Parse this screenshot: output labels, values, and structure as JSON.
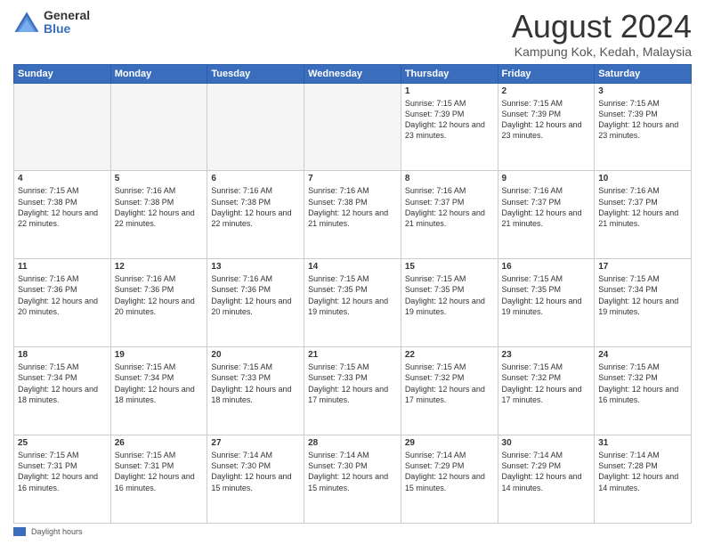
{
  "logo": {
    "general": "General",
    "blue": "Blue"
  },
  "header": {
    "month_year": "August 2024",
    "location": "Kampung Kok, Kedah, Malaysia"
  },
  "days_of_week": [
    "Sunday",
    "Monday",
    "Tuesday",
    "Wednesday",
    "Thursday",
    "Friday",
    "Saturday"
  ],
  "footer": {
    "swatch_label": "Daylight hours"
  },
  "weeks": [
    [
      {
        "day": "",
        "empty": true
      },
      {
        "day": "",
        "empty": true
      },
      {
        "day": "",
        "empty": true
      },
      {
        "day": "",
        "empty": true
      },
      {
        "day": "1",
        "sunrise": "7:15 AM",
        "sunset": "7:39 PM",
        "daylight": "12 hours and 23 minutes."
      },
      {
        "day": "2",
        "sunrise": "7:15 AM",
        "sunset": "7:39 PM",
        "daylight": "12 hours and 23 minutes."
      },
      {
        "day": "3",
        "sunrise": "7:15 AM",
        "sunset": "7:39 PM",
        "daylight": "12 hours and 23 minutes."
      }
    ],
    [
      {
        "day": "4",
        "sunrise": "7:15 AM",
        "sunset": "7:38 PM",
        "daylight": "12 hours and 22 minutes."
      },
      {
        "day": "5",
        "sunrise": "7:16 AM",
        "sunset": "7:38 PM",
        "daylight": "12 hours and 22 minutes."
      },
      {
        "day": "6",
        "sunrise": "7:16 AM",
        "sunset": "7:38 PM",
        "daylight": "12 hours and 22 minutes."
      },
      {
        "day": "7",
        "sunrise": "7:16 AM",
        "sunset": "7:38 PM",
        "daylight": "12 hours and 21 minutes."
      },
      {
        "day": "8",
        "sunrise": "7:16 AM",
        "sunset": "7:37 PM",
        "daylight": "12 hours and 21 minutes."
      },
      {
        "day": "9",
        "sunrise": "7:16 AM",
        "sunset": "7:37 PM",
        "daylight": "12 hours and 21 minutes."
      },
      {
        "day": "10",
        "sunrise": "7:16 AM",
        "sunset": "7:37 PM",
        "daylight": "12 hours and 21 minutes."
      }
    ],
    [
      {
        "day": "11",
        "sunrise": "7:16 AM",
        "sunset": "7:36 PM",
        "daylight": "12 hours and 20 minutes."
      },
      {
        "day": "12",
        "sunrise": "7:16 AM",
        "sunset": "7:36 PM",
        "daylight": "12 hours and 20 minutes."
      },
      {
        "day": "13",
        "sunrise": "7:16 AM",
        "sunset": "7:36 PM",
        "daylight": "12 hours and 20 minutes."
      },
      {
        "day": "14",
        "sunrise": "7:15 AM",
        "sunset": "7:35 PM",
        "daylight": "12 hours and 19 minutes."
      },
      {
        "day": "15",
        "sunrise": "7:15 AM",
        "sunset": "7:35 PM",
        "daylight": "12 hours and 19 minutes."
      },
      {
        "day": "16",
        "sunrise": "7:15 AM",
        "sunset": "7:35 PM",
        "daylight": "12 hours and 19 minutes."
      },
      {
        "day": "17",
        "sunrise": "7:15 AM",
        "sunset": "7:34 PM",
        "daylight": "12 hours and 19 minutes."
      }
    ],
    [
      {
        "day": "18",
        "sunrise": "7:15 AM",
        "sunset": "7:34 PM",
        "daylight": "12 hours and 18 minutes."
      },
      {
        "day": "19",
        "sunrise": "7:15 AM",
        "sunset": "7:34 PM",
        "daylight": "12 hours and 18 minutes."
      },
      {
        "day": "20",
        "sunrise": "7:15 AM",
        "sunset": "7:33 PM",
        "daylight": "12 hours and 18 minutes."
      },
      {
        "day": "21",
        "sunrise": "7:15 AM",
        "sunset": "7:33 PM",
        "daylight": "12 hours and 17 minutes."
      },
      {
        "day": "22",
        "sunrise": "7:15 AM",
        "sunset": "7:32 PM",
        "daylight": "12 hours and 17 minutes."
      },
      {
        "day": "23",
        "sunrise": "7:15 AM",
        "sunset": "7:32 PM",
        "daylight": "12 hours and 17 minutes."
      },
      {
        "day": "24",
        "sunrise": "7:15 AM",
        "sunset": "7:32 PM",
        "daylight": "12 hours and 16 minutes."
      }
    ],
    [
      {
        "day": "25",
        "sunrise": "7:15 AM",
        "sunset": "7:31 PM",
        "daylight": "12 hours and 16 minutes."
      },
      {
        "day": "26",
        "sunrise": "7:15 AM",
        "sunset": "7:31 PM",
        "daylight": "12 hours and 16 minutes."
      },
      {
        "day": "27",
        "sunrise": "7:14 AM",
        "sunset": "7:30 PM",
        "daylight": "12 hours and 15 minutes."
      },
      {
        "day": "28",
        "sunrise": "7:14 AM",
        "sunset": "7:30 PM",
        "daylight": "12 hours and 15 minutes."
      },
      {
        "day": "29",
        "sunrise": "7:14 AM",
        "sunset": "7:29 PM",
        "daylight": "12 hours and 15 minutes."
      },
      {
        "day": "30",
        "sunrise": "7:14 AM",
        "sunset": "7:29 PM",
        "daylight": "12 hours and 14 minutes."
      },
      {
        "day": "31",
        "sunrise": "7:14 AM",
        "sunset": "7:28 PM",
        "daylight": "12 hours and 14 minutes."
      }
    ]
  ]
}
